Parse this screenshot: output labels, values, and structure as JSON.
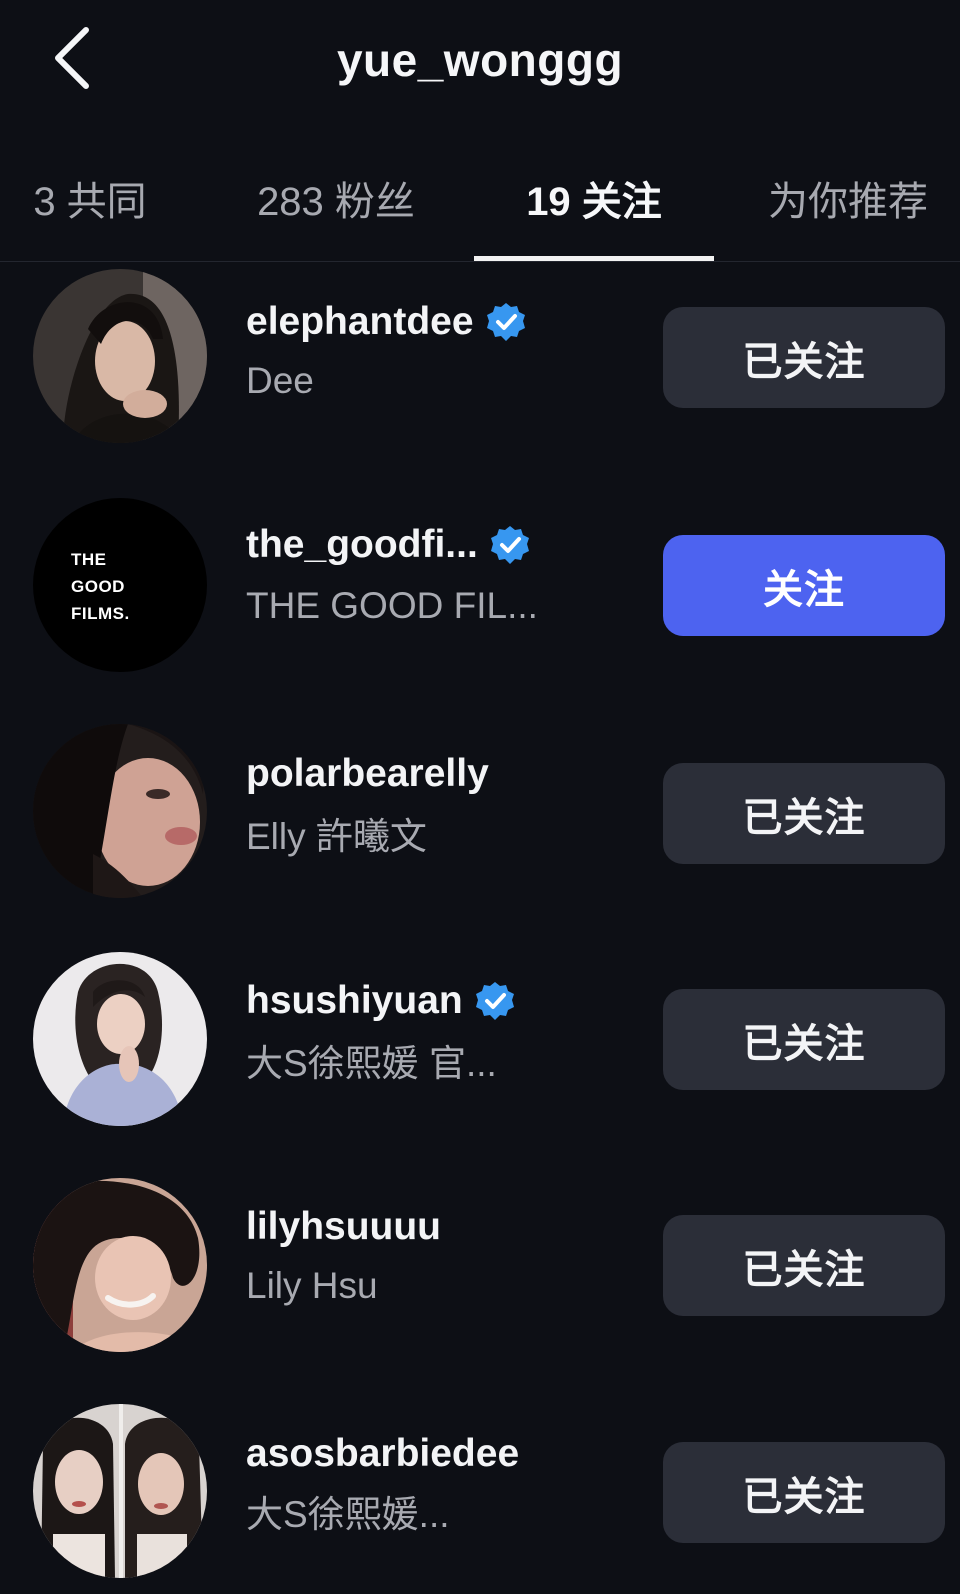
{
  "header": {
    "title": "yue_wonggg",
    "back_icon": "chevron-left-icon"
  },
  "tabs": [
    {
      "label": "3 共同",
      "active": false
    },
    {
      "label": "283 粉丝",
      "active": false
    },
    {
      "label": "19 关注",
      "active": true
    },
    {
      "label": "为你推荐",
      "active": false
    }
  ],
  "users": [
    {
      "username": "elephantdee",
      "name": "Dee",
      "verified": true,
      "button": "已关注",
      "avatar_icon": "user-avatar-photo"
    },
    {
      "username": "the_goodfi...",
      "name": "THE GOOD FIL...",
      "verified": true,
      "button": "关注",
      "avatar_icon": "the-good-films-logo",
      "logo_text": [
        "THE",
        "GOOD",
        "FILMS."
      ]
    },
    {
      "username": "polarbearelly",
      "name": "Elly 許曦文",
      "verified": false,
      "button": "已关注",
      "avatar_icon": "user-avatar-photo"
    },
    {
      "username": "hsushiyuan",
      "name": "大S徐熙媛  官...",
      "verified": true,
      "button": "已关注",
      "avatar_icon": "user-avatar-photo"
    },
    {
      "username": "lilyhsuuuu",
      "name": "Lily Hsu",
      "verified": false,
      "button": "已关注",
      "avatar_icon": "user-avatar-photo"
    },
    {
      "username": "asosbarbiedee",
      "name": "大S徐熙媛...",
      "verified": false,
      "button": "已关注",
      "avatar_icon": "user-avatar-photo"
    }
  ],
  "colors": {
    "background": "#0d0f15",
    "verified_badge": "#3797f0",
    "follow_primary": "#4d63f0",
    "following_button": "#2b2e38"
  }
}
